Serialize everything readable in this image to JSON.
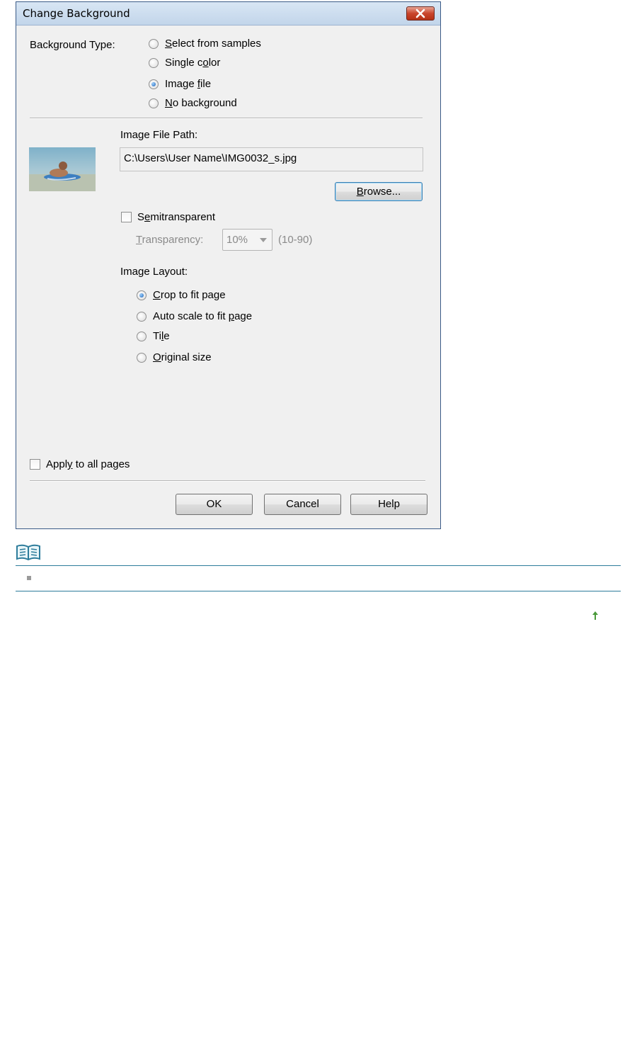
{
  "dialog": {
    "title": "Change Background",
    "background_type_label": "Background Type:",
    "background_types": [
      {
        "pre": "",
        "u": "S",
        "post": "elect from samples",
        "selected": false
      },
      {
        "pre": "Single c",
        "u": "o",
        "post": "lor",
        "selected": false
      },
      {
        "pre": "Image ",
        "u": "f",
        "post": "ile",
        "selected": true
      },
      {
        "pre": "",
        "u": "N",
        "post": "o background",
        "selected": false
      }
    ],
    "image_file_path_label": "Image File Path:",
    "image_file_path": "C:\\Users\\User Name\\IMG0032_s.jpg",
    "browse": {
      "u": "B",
      "post": "rowse..."
    },
    "semitransparent": {
      "pre": "S",
      "u": "e",
      "post": "mitransparent",
      "checked": false
    },
    "transparency": {
      "u": "T",
      "post": "ransparency:",
      "value": "10%",
      "range": "(10-90)"
    },
    "image_layout_label": "Image Layout:",
    "layouts": [
      {
        "pre": "",
        "u": "C",
        "post": "rop to fit page",
        "selected": true
      },
      {
        "pre": "Auto scale to fit ",
        "u": "p",
        "post": "age",
        "selected": false
      },
      {
        "pre": "Ti",
        "u": "l",
        "post": "e",
        "selected": false
      },
      {
        "pre": "",
        "u": "O",
        "post": "riginal size",
        "selected": false
      }
    ],
    "apply_all": {
      "pre": "Appl",
      "u": "y",
      "post": " to all pages",
      "checked": false
    },
    "ok_label": "OK",
    "cancel_label": "Cancel",
    "help_label": "Help"
  },
  "colors": {
    "accent": "#2d7c9b",
    "title_close": "#c9452c",
    "up_arrow": "#4a9a3a"
  },
  "icons": {
    "note": "note-book-icon",
    "up": "up-arrow-icon",
    "bullet": "bullet-square-icon"
  }
}
